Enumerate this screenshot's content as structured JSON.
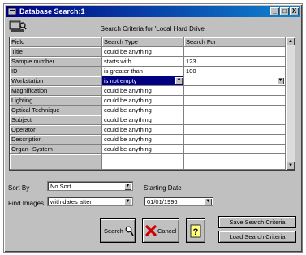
{
  "window": {
    "title": "Database Search:1",
    "min_label": "_",
    "max_label": "□",
    "close_label": "X"
  },
  "criteria_title": "Search Criteria for 'Local Hard Drive'",
  "table": {
    "headers": [
      "Field",
      "Search Type",
      "Search For"
    ],
    "rows": [
      {
        "field": "Title",
        "type": "could be anything",
        "value": ""
      },
      {
        "field": "Sample number",
        "type": "starts with",
        "value": "123"
      },
      {
        "field": "ID",
        "type": "is greater than",
        "value": "100"
      },
      {
        "field": "Workstation",
        "type": "is not empty",
        "value": ""
      },
      {
        "field": "Magnification",
        "type": "could be anything",
        "value": ""
      },
      {
        "field": "Lighting",
        "type": "could be anything",
        "value": ""
      },
      {
        "field": "Optical Technique",
        "type": "could be anything",
        "value": ""
      },
      {
        "field": "Subject",
        "type": "could be anything",
        "value": ""
      },
      {
        "field": "Operator",
        "type": "could be anything",
        "value": ""
      },
      {
        "field": "Description",
        "type": "could be anything",
        "value": ""
      },
      {
        "field": "Organ--System",
        "type": "could be anything",
        "value": ""
      }
    ]
  },
  "sort_by": {
    "label": "Sort By",
    "value": "No Sort"
  },
  "find_images": {
    "label": "Find Images",
    "value": "with dates after"
  },
  "starting_date": {
    "label": "Starting Date",
    "value": "01/01/1996"
  },
  "buttons": {
    "search": "Search",
    "cancel": "Cancel",
    "save_criteria": "Save Search Criteria",
    "load_criteria": "Load Search Criteria"
  },
  "colors": {
    "titlebar": "#000080",
    "selection": "#000080",
    "face": "#c0c0c0"
  }
}
